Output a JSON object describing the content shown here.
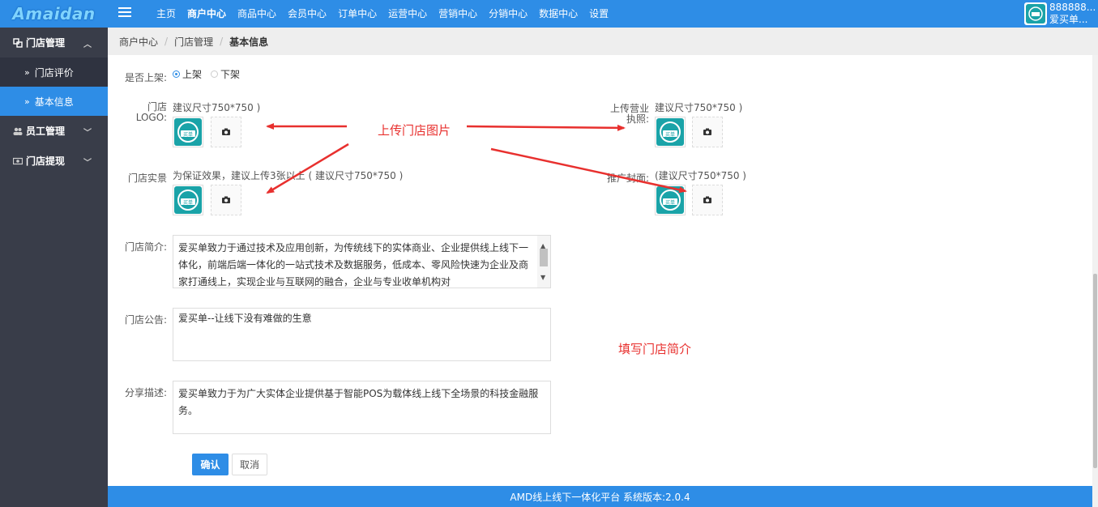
{
  "brand": {
    "logo_text": "Amaidan"
  },
  "topnav": {
    "items": [
      "主页",
      "商户中心",
      "商品中心",
      "会员中心",
      "订单中心",
      "运营中心",
      "营销中心",
      "分销中心",
      "数据中心",
      "设置"
    ],
    "active_index": 1
  },
  "user": {
    "id_text": "888888...",
    "name": "爱买单..."
  },
  "sidebar": {
    "groups": [
      {
        "label": "门店管理",
        "open": true,
        "icon": "store-icon",
        "subs": [
          {
            "label": "门店评价",
            "active": false
          },
          {
            "label": "基本信息",
            "active": true
          }
        ]
      },
      {
        "label": "员工管理",
        "open": false,
        "icon": "users-icon"
      },
      {
        "label": "门店提现",
        "open": false,
        "icon": "cash-icon"
      }
    ]
  },
  "breadcrumb": [
    "商户中心",
    "门店管理",
    "基本信息"
  ],
  "form": {
    "listing": {
      "label": "是否上架:",
      "options": [
        "上架",
        "下架"
      ],
      "selected": "上架"
    },
    "logo": {
      "label_line1": "门店",
      "label_line2": "LOGO:",
      "hint": "建议尺寸750*750 )"
    },
    "license": {
      "label_line1": "上传营业",
      "label_line2": "执照:",
      "hint": "建议尺寸750*750 )"
    },
    "photos": {
      "label": "门店实景",
      "hint": "为保证效果，建议上传3张以上 ( 建议尺寸750*750 )"
    },
    "cover": {
      "label": "推广封面:",
      "hint": "(建议尺寸750*750 )"
    },
    "intro": {
      "label": "门店简介:",
      "value": "爱买单致力于通过技术及应用创新，为传统线下的实体商业、企业提供线上线下一体化，前端后端一体化的一站式技术及数据服务，低成本、零风险快速为企业及商家打通线上，实现企业与互联网的融合，企业与专业收单机构对"
    },
    "notice": {
      "label": "门店公告:",
      "value": "爱买单--让线下没有难做的生意"
    },
    "share": {
      "label": "分享描述:",
      "value": "爱买单致力于为广大实体企业提供基于智能POS为载体线上线下全场景的科技金融服务。"
    },
    "thumb_text": "买单"
  },
  "buttons": {
    "confirm": "确认",
    "cancel": "取消"
  },
  "annotations": {
    "upload": "上传门店图片",
    "fill": "填写门店简介"
  },
  "footer": {
    "text": "AMD线上线下一体化平台 系统版本:2.0.4"
  },
  "colors": {
    "primary": "#2e8de6",
    "sidebar": "#393d49",
    "annotation": "#e8302e",
    "thumb": "#1aa3a8"
  }
}
